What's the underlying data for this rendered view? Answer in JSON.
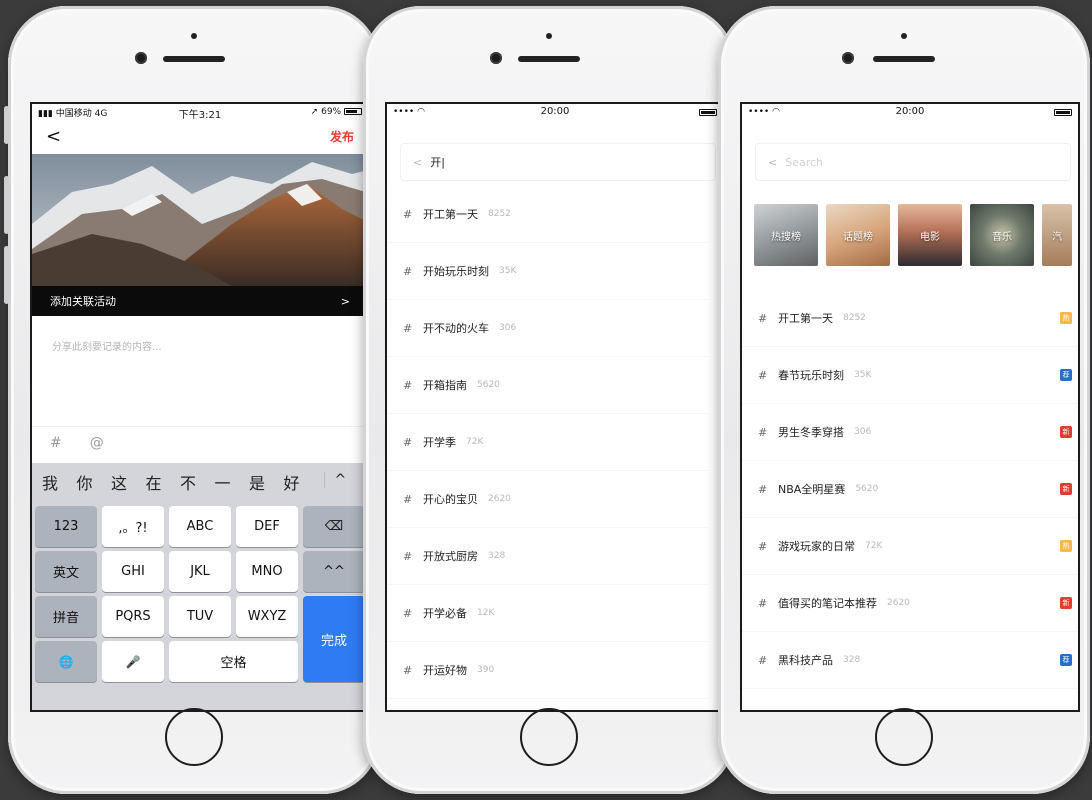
{
  "colors": {
    "accent_red": "#e43f2e",
    "key_blue": "#2f7bf4",
    "badge_hot": "#f5b944",
    "badge_rec": "#2a6cc9",
    "badge_new": "#e33b2e"
  },
  "phone1": {
    "status": {
      "carrier": "中国移动",
      "network": "4G",
      "time": "下午3:21",
      "battery": "69%"
    },
    "nav": {
      "back": "<",
      "publish": "发布"
    },
    "activity": {
      "label": "添加关联活动",
      "arrow": ">"
    },
    "compose": {
      "placeholder": "分享此刻要记录的内容..."
    },
    "tools": {
      "hash": "#",
      "at": "@"
    },
    "candidates": [
      "我",
      "你",
      "这",
      "在",
      "不",
      "一",
      "是",
      "好"
    ],
    "candidate_caret": "^",
    "keys": {
      "k123": "123",
      "punct": ",。?!",
      "abc": "ABC",
      "def": "DEF",
      "delete": "⌫",
      "lang": "英文",
      "ghi": "GHI",
      "jkl": "JKL",
      "mno": "MNO",
      "emoji": "^^",
      "pinyin": "拼音",
      "pqrs": "PQRS",
      "tuv": "TUV",
      "wxyz": "WXYZ",
      "done": "完成",
      "globe": "🌐",
      "mic": "🎤",
      "space": "空格"
    }
  },
  "phone2": {
    "status": {
      "signal": "••••",
      "time": "20:00"
    },
    "search": {
      "back": "<",
      "value": "开|"
    },
    "topics": [
      {
        "hash": "#",
        "name": "开工第一天",
        "count": "8252"
      },
      {
        "hash": "#",
        "name": "开始玩乐时刻",
        "count": "35K"
      },
      {
        "hash": "#",
        "name": "开不动的火车",
        "count": "306"
      },
      {
        "hash": "#",
        "name": "开箱指南",
        "count": "5620"
      },
      {
        "hash": "#",
        "name": "开学季",
        "count": "72K"
      },
      {
        "hash": "#",
        "name": "开心的宝贝",
        "count": "2620"
      },
      {
        "hash": "#",
        "name": "开放式厨房",
        "count": "328"
      },
      {
        "hash": "#",
        "name": "开学必备",
        "count": "12K"
      },
      {
        "hash": "#",
        "name": "开运好物",
        "count": "390"
      }
    ]
  },
  "phone3": {
    "status": {
      "signal": "••••",
      "time": "20:00"
    },
    "search": {
      "back": "<",
      "placeholder": "Search"
    },
    "categories": [
      "热搜榜",
      "话题榜",
      "电影",
      "音乐",
      "汽"
    ],
    "topics": [
      {
        "hash": "#",
        "name": "开工第一天",
        "count": "8252",
        "badge": "热",
        "badge_type": "hot"
      },
      {
        "hash": "#",
        "name": "春节玩乐时刻",
        "count": "35K",
        "badge": "荐",
        "badge_type": "rec"
      },
      {
        "hash": "#",
        "name": "男生冬季穿搭",
        "count": "306",
        "badge": "新",
        "badge_type": "new"
      },
      {
        "hash": "#",
        "name": "NBA全明星赛",
        "count": "5620",
        "badge": "新",
        "badge_type": "new"
      },
      {
        "hash": "#",
        "name": "游戏玩家的日常",
        "count": "72K",
        "badge": "热",
        "badge_type": "hot"
      },
      {
        "hash": "#",
        "name": "值得买的笔记本推荐",
        "count": "2620",
        "badge": "新",
        "badge_type": "new"
      },
      {
        "hash": "#",
        "name": "黑科技产品",
        "count": "328",
        "badge": "荐",
        "badge_type": "rec"
      }
    ]
  }
}
